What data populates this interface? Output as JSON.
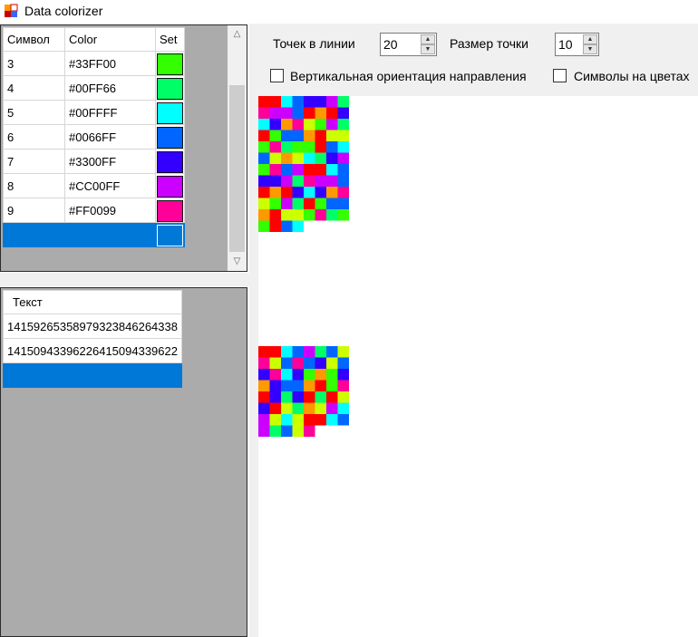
{
  "window": {
    "title": "Data colorizer"
  },
  "symbol_table": {
    "headers": [
      "Символ",
      "Color",
      "Set"
    ],
    "rows": [
      {
        "symbol": "3",
        "color_text": "#33FF00",
        "swatch": "#33FF00"
      },
      {
        "symbol": "4",
        "color_text": "#00FF66",
        "swatch": "#00FF66"
      },
      {
        "symbol": "5",
        "color_text": "#00FFFF",
        "swatch": "#00FFFF"
      },
      {
        "symbol": "6",
        "color_text": "#0066FF",
        "swatch": "#0066FF"
      },
      {
        "symbol": "7",
        "color_text": "#3300FF",
        "swatch": "#3300FF"
      },
      {
        "symbol": "8",
        "color_text": "#CC00FF",
        "swatch": "#CC00FF"
      },
      {
        "symbol": "9",
        "color_text": "#FF0099",
        "swatch": "#FF0099"
      }
    ]
  },
  "text_table": {
    "header": "Текст",
    "rows": [
      "14159265358979323846264338",
      "14150943396226415094339622"
    ]
  },
  "toolbar": {
    "points_label": "Точек в линии",
    "points_value": "20",
    "size_label": "Размер точки",
    "size_value": "10",
    "vertical_label": "Вертикальная ориентация направления",
    "symbols_label": "Символы на цветах"
  },
  "palette": {
    "0": "#FF9900",
    "1": "#FF0000",
    "2": "#CCFF00",
    "3": "#33FF00",
    "4": "#00FF66",
    "5": "#00FFFF",
    "6": "#0066FF",
    "7": "#3300FF",
    "8": "#CC00FF",
    "9": "#FF0099"
  },
  "mosaic_blocks": [
    {
      "cell_count": 92
    },
    {
      "cell_count": 61
    }
  ]
}
